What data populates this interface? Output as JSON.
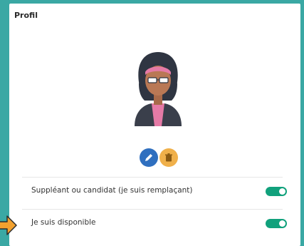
{
  "card": {
    "title": "Profil"
  },
  "actions": {
    "edit_icon": "pencil-icon",
    "delete_icon": "trash-icon"
  },
  "settings": [
    {
      "label": "Suppléant ou candidat (je suis remplaçant)",
      "enabled": true
    },
    {
      "label": "Je suis disponible",
      "enabled": true
    }
  ],
  "colors": {
    "background": "#3aa8a4",
    "toggle_on": "#11a17c",
    "edit_button": "#2f6fbf",
    "delete_button": "#f0b04a",
    "pointer": "#f2a12e"
  }
}
